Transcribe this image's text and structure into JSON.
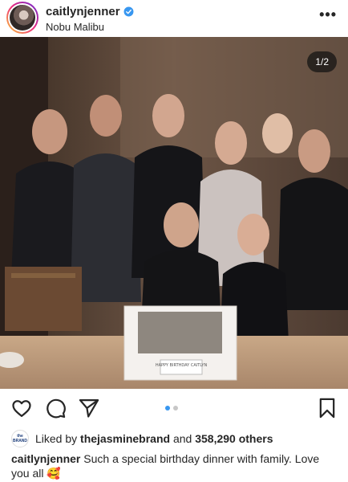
{
  "post": {
    "username": "caitlynjenner",
    "location": "Nobu Malibu",
    "more_icon": "more-horizontal-icon",
    "counter": "1/2",
    "cake_text": "HAPPY BIRTHDAY CAITLYN"
  },
  "carousel": {
    "current": 1,
    "total": 2
  },
  "actions": {
    "icons": [
      "heart-icon",
      "comment-icon",
      "share-icon",
      "bookmark-icon"
    ]
  },
  "likes": {
    "avatar_text": "the BRAND",
    "prefix": "Liked by",
    "liker": "thejasminebrand",
    "middle": "and",
    "count_text": "358,290 others"
  },
  "caption": {
    "username": "caitlynjenner",
    "text": "Such a special birthday dinner with family. Love you all 🥰"
  },
  "colors": {
    "accent": "#3897f0",
    "text": "#262626"
  }
}
